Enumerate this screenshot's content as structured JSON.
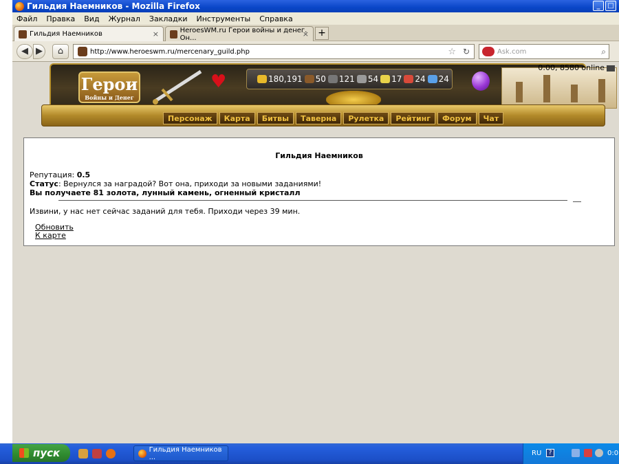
{
  "window": {
    "title": "Гильдия Наемников - Mozilla Firefox"
  },
  "menu": [
    "Файл",
    "Правка",
    "Вид",
    "Журнал",
    "Закладки",
    "Инструменты",
    "Справка"
  ],
  "tabs": [
    {
      "label": "Гильдия Наемников",
      "active": true
    },
    {
      "label": "HeroesWM.ru Герои войны и денег. Он...",
      "active": false
    }
  ],
  "navbar": {
    "url": "http://www.heroeswm.ru/mercenary_guild.php",
    "search_placeholder": "Ask.com"
  },
  "game_header": {
    "logo_title": "Герои",
    "logo_subtitle": "Войны и Денег",
    "online_status": "0:00, 8580 online",
    "resources": [
      {
        "icon": "gold-icon",
        "value": "180,191",
        "color": "#e8b92a"
      },
      {
        "icon": "wood-icon",
        "value": "50",
        "color": "#8a5a2a"
      },
      {
        "icon": "ore-icon",
        "value": "121",
        "color": "#777777"
      },
      {
        "icon": "mercury-icon",
        "value": "54",
        "color": "#9a9a9a"
      },
      {
        "icon": "sulfur-icon",
        "value": "17",
        "color": "#e8d24a"
      },
      {
        "icon": "crystal-icon",
        "value": "24",
        "color": "#d84a3a"
      },
      {
        "icon": "gems-icon",
        "value": "24",
        "color": "#5aa0e8"
      }
    ],
    "nav_items": [
      "Персонаж",
      "Карта",
      "Битвы",
      "Таверна",
      "Рулетка",
      "Рейтинг",
      "Форум",
      "Чат"
    ]
  },
  "guild": {
    "title": "Гильдия Наемников",
    "reputation_label": "Репутация: ",
    "reputation_value": "0.5",
    "status_label": "Статус",
    "status_text": ": Вернулся за наградой? Вот она, приходи за новыми заданиями!",
    "reward_text": "Вы получаете 81 золота, лунный камень, огненный кристалл",
    "no_tasks_text": "Извини, у нас нет сейчас заданий для тебя. Приходи через 39 мин.",
    "links": [
      "Обновить",
      "К карте"
    ]
  },
  "taskbar": {
    "start_label": "пуск",
    "task_label": "Гильдия Наемников ...",
    "lang": "RU",
    "clock": "0:0"
  }
}
